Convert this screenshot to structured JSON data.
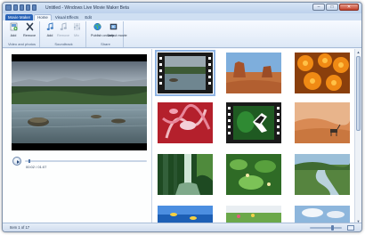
{
  "window": {
    "title": "Untitled - Windows Live Movie Maker Beta",
    "controls": {
      "minimize": "–",
      "maximize": "□",
      "close": "✕"
    }
  },
  "ribbon_tabs": [
    {
      "label": "Movie Maker",
      "kind": "app"
    },
    {
      "label": "Home",
      "kind": "active"
    },
    {
      "label": "Visual Effects",
      "kind": "normal"
    },
    {
      "label": "Edit",
      "kind": "normal"
    }
  ],
  "ribbon": {
    "groups": {
      "video_photos": {
        "label": "Video and photos",
        "buttons": [
          {
            "label": "Add",
            "icon": "add-icon"
          },
          {
            "label": "Remove",
            "icon": "remove-icon"
          }
        ]
      },
      "soundtrack": {
        "label": "Soundtrack",
        "buttons": [
          {
            "label": "Add",
            "icon": "music-add-icon",
            "enabled": true
          },
          {
            "label": "Remove",
            "icon": "music-remove-icon",
            "enabled": false
          },
          {
            "label": "Mix",
            "icon": "mix-icon",
            "enabled": false
          }
        ]
      },
      "share": {
        "label": "Share",
        "buttons": [
          {
            "label": "Publish on web",
            "icon": "globe-icon"
          },
          {
            "label": "Output movie",
            "icon": "movie-icon"
          }
        ]
      }
    }
  },
  "preview": {
    "time": "00:02 / 01:07",
    "progress": 0.03
  },
  "storyboard": {
    "items": [
      {
        "name": "river-clip",
        "type": "video",
        "selected": true
      },
      {
        "name": "desert-buttes",
        "type": "photo"
      },
      {
        "name": "orange-flowers",
        "type": "photo"
      },
      {
        "name": "red-tapestry",
        "type": "photo"
      },
      {
        "name": "butterfly-clip",
        "type": "video"
      },
      {
        "name": "sand-dunes-oryx",
        "type": "photo"
      },
      {
        "name": "forest-waterfall",
        "type": "photo"
      },
      {
        "name": "green-foliage",
        "type": "photo"
      },
      {
        "name": "stream-valley",
        "type": "photo"
      },
      {
        "name": "underwater-fish",
        "type": "photo"
      },
      {
        "name": "spring-meadow",
        "type": "photo"
      },
      {
        "name": "clouds-sky",
        "type": "photo"
      }
    ]
  },
  "status": {
    "item_text": "Item 1 of 17",
    "zoom_level": 0.72
  },
  "colors": {
    "accent": "#2a64b8",
    "ribbon_bg": "#dde8f6",
    "selection": "#8fb4e3"
  }
}
